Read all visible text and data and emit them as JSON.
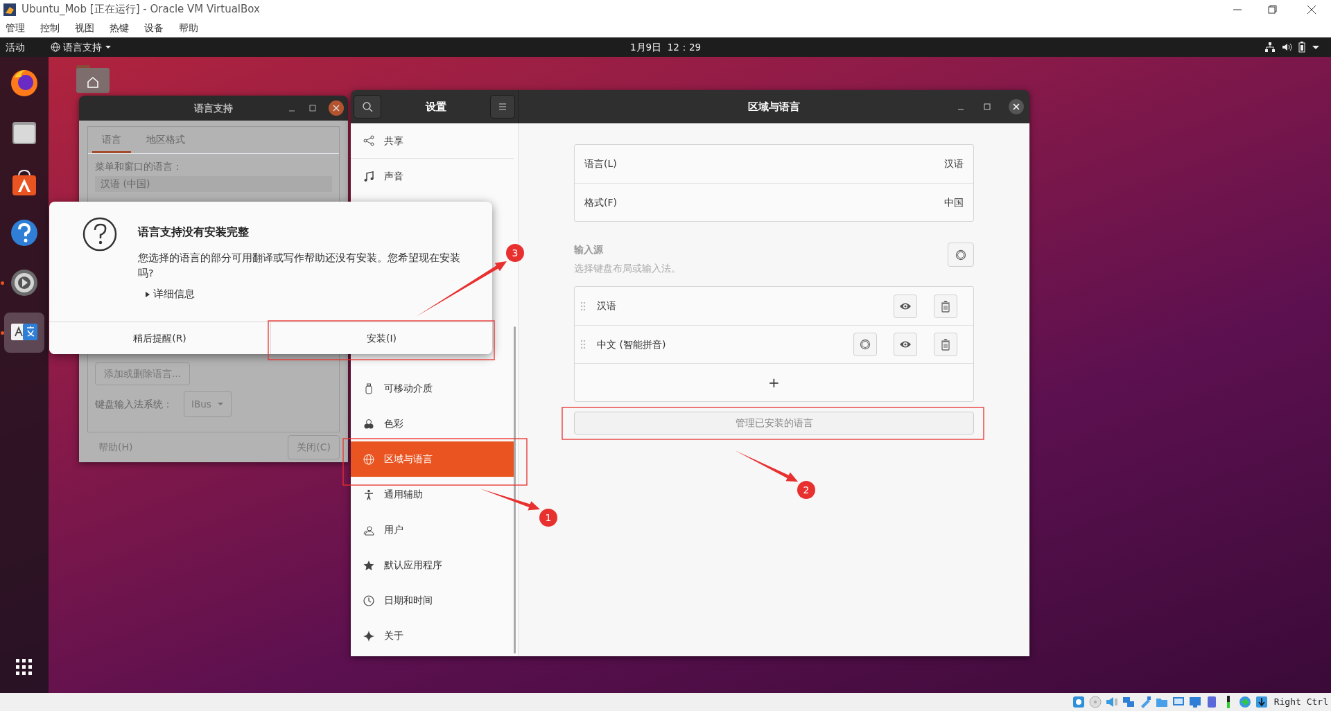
{
  "host_window": {
    "title": "Ubuntu_Mob [正在运行] - Oracle VM VirtualBox",
    "menu": [
      "管理",
      "控制",
      "视图",
      "热键",
      "设备",
      "帮助"
    ]
  },
  "top_bar": {
    "activities": "活动",
    "app_menu": "语言支持",
    "clock": "1月9日  12：29"
  },
  "dock": {
    "apps": [
      {
        "kind": "firefox",
        "running": false,
        "selected": false
      },
      {
        "kind": "files",
        "running": false,
        "selected": false
      },
      {
        "kind": "software",
        "running": false,
        "selected": false
      },
      {
        "kind": "help",
        "running": false,
        "selected": false
      },
      {
        "kind": "settings",
        "running": true,
        "selected": false
      },
      {
        "kind": "language",
        "running": true,
        "selected": true
      }
    ]
  },
  "language_window": {
    "title": "语言支持",
    "tabs": [
      {
        "label": "语言",
        "selected": true
      },
      {
        "label": "地区格式",
        "selected": false
      }
    ],
    "languages_label": "菜单和窗口的语言：",
    "languages": [
      "汉语 (中国)"
    ],
    "add_remove_button": "添加或删除语言...",
    "input_system_label": "键盘输入法系统：",
    "input_system": "IBus",
    "help_button": "帮助(H)",
    "close_button": "关闭(C)"
  },
  "settings": {
    "title": "设置",
    "sidebar": {
      "upper_items": [
        {
          "label": "共享",
          "kind": "share",
          "selected": false
        },
        {
          "label": "声音",
          "kind": "sound",
          "selected": false
        }
      ],
      "lower_items": [
        {
          "label": "可移动介质",
          "kind": "removable",
          "selected": false
        },
        {
          "label": "色彩",
          "kind": "color",
          "selected": false
        },
        {
          "label": "区域与语言",
          "kind": "region",
          "selected": true
        },
        {
          "label": "通用辅助",
          "kind": "access",
          "selected": false
        },
        {
          "label": "用户",
          "kind": "users",
          "selected": false
        },
        {
          "label": "默认应用程序",
          "kind": "star",
          "selected": false
        },
        {
          "label": "日期和时间",
          "kind": "clock",
          "selected": false
        },
        {
          "label": "关于",
          "kind": "about",
          "selected": false
        }
      ]
    },
    "panel": {
      "title": "区域与语言",
      "rows": [
        {
          "label": "语言(L)",
          "value": "汉语"
        },
        {
          "label": "格式(F)",
          "value": "中国"
        }
      ],
      "input_sources_title": "输入源",
      "input_sources_hint": "选择键盘布局或输入法。",
      "input_sources": [
        {
          "name": "汉语",
          "has_settings": false
        },
        {
          "name": "中文 (智能拼音)",
          "has_settings": true
        }
      ],
      "add_button": "+",
      "manage_button": "管理已安装的语言"
    }
  },
  "dialog": {
    "title": "语言支持没有安装完整",
    "message": "您选择的语言的部分可用翻译或写作帮助还没有安装。您希望现在安装吗?",
    "details": "详细信息",
    "expanded": false,
    "buttons": [
      "稍后提醒(R)",
      "安装(I)"
    ]
  },
  "annotations": [
    {
      "label": "1"
    },
    {
      "label": "2"
    },
    {
      "label": "3"
    }
  ],
  "status_bar": {
    "host_key": "Right Ctrl"
  }
}
